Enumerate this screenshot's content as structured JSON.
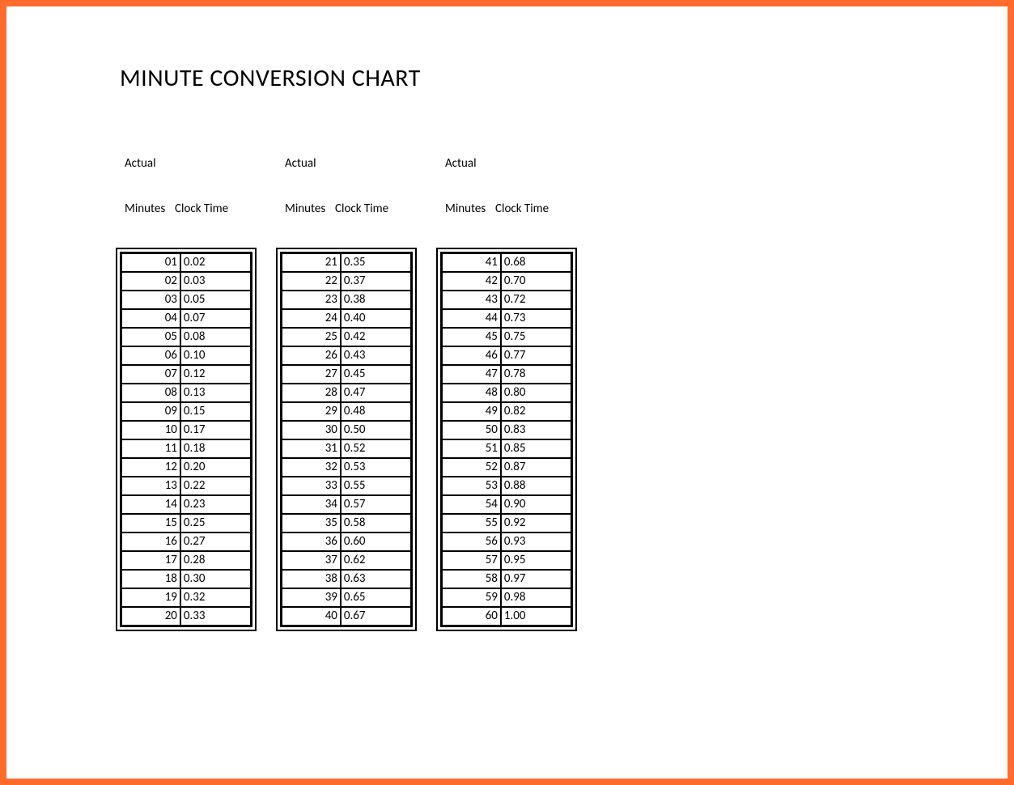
{
  "title": "MINUTE CONVERSION CHART",
  "headers": {
    "line1": "Actual",
    "col1": "Minutes",
    "col2": "Clock Time"
  },
  "chart_data": {
    "type": "table",
    "title": "Minute Conversion Chart",
    "columns": [
      "Actual Minutes",
      "Clock Time"
    ],
    "rows": [
      [
        "01",
        "0.02"
      ],
      [
        "02",
        "0.03"
      ],
      [
        "03",
        "0.05"
      ],
      [
        "04",
        "0.07"
      ],
      [
        "05",
        "0.08"
      ],
      [
        "06",
        "0.10"
      ],
      [
        "07",
        "0.12"
      ],
      [
        "08",
        "0.13"
      ],
      [
        "09",
        "0.15"
      ],
      [
        "10",
        "0.17"
      ],
      [
        "11",
        "0.18"
      ],
      [
        "12",
        "0.20"
      ],
      [
        "13",
        "0.22"
      ],
      [
        "14",
        "0.23"
      ],
      [
        "15",
        "0.25"
      ],
      [
        "16",
        "0.27"
      ],
      [
        "17",
        "0.28"
      ],
      [
        "18",
        "0.30"
      ],
      [
        "19",
        "0.32"
      ],
      [
        "20",
        "0.33"
      ],
      [
        "21",
        "0.35"
      ],
      [
        "22",
        "0.37"
      ],
      [
        "23",
        "0.38"
      ],
      [
        "24",
        "0.40"
      ],
      [
        "25",
        "0.42"
      ],
      [
        "26",
        "0.43"
      ],
      [
        "27",
        "0.45"
      ],
      [
        "28",
        "0.47"
      ],
      [
        "29",
        "0.48"
      ],
      [
        "30",
        "0.50"
      ],
      [
        "31",
        "0.52"
      ],
      [
        "32",
        "0.53"
      ],
      [
        "33",
        "0.55"
      ],
      [
        "34",
        "0.57"
      ],
      [
        "35",
        "0.58"
      ],
      [
        "36",
        "0.60"
      ],
      [
        "37",
        "0.62"
      ],
      [
        "38",
        "0.63"
      ],
      [
        "39",
        "0.65"
      ],
      [
        "40",
        "0.67"
      ],
      [
        "41",
        "0.68"
      ],
      [
        "42",
        "0.70"
      ],
      [
        "43",
        "0.72"
      ],
      [
        "44",
        "0.73"
      ],
      [
        "45",
        "0.75"
      ],
      [
        "46",
        "0.77"
      ],
      [
        "47",
        "0.78"
      ],
      [
        "48",
        "0.80"
      ],
      [
        "49",
        "0.82"
      ],
      [
        "50",
        "0.83"
      ],
      [
        "51",
        "0.85"
      ],
      [
        "52",
        "0.87"
      ],
      [
        "53",
        "0.88"
      ],
      [
        "54",
        "0.90"
      ],
      [
        "55",
        "0.92"
      ],
      [
        "56",
        "0.93"
      ],
      [
        "57",
        "0.95"
      ],
      [
        "58",
        "0.97"
      ],
      [
        "59",
        "0.98"
      ],
      [
        "60",
        "1.00"
      ]
    ]
  },
  "columns": [
    {
      "rows": [
        {
          "m": "01",
          "c": "0.02"
        },
        {
          "m": "02",
          "c": "0.03"
        },
        {
          "m": "03",
          "c": "0.05"
        },
        {
          "m": "04",
          "c": "0.07"
        },
        {
          "m": "05",
          "c": "0.08"
        },
        {
          "m": "06",
          "c": "0.10"
        },
        {
          "m": "07",
          "c": "0.12"
        },
        {
          "m": "08",
          "c": "0.13"
        },
        {
          "m": "09",
          "c": "0.15"
        },
        {
          "m": "10",
          "c": "0.17"
        },
        {
          "m": "11",
          "c": "0.18"
        },
        {
          "m": "12",
          "c": "0.20"
        },
        {
          "m": "13",
          "c": "0.22"
        },
        {
          "m": "14",
          "c": "0.23"
        },
        {
          "m": "15",
          "c": "0.25"
        },
        {
          "m": "16",
          "c": "0.27"
        },
        {
          "m": "17",
          "c": "0.28"
        },
        {
          "m": "18",
          "c": "0.30"
        },
        {
          "m": "19",
          "c": "0.32"
        },
        {
          "m": "20",
          "c": "0.33"
        }
      ]
    },
    {
      "rows": [
        {
          "m": "21",
          "c": "0.35"
        },
        {
          "m": "22",
          "c": "0.37"
        },
        {
          "m": "23",
          "c": "0.38"
        },
        {
          "m": "24",
          "c": "0.40"
        },
        {
          "m": "25",
          "c": "0.42"
        },
        {
          "m": "26",
          "c": "0.43"
        },
        {
          "m": "27",
          "c": "0.45"
        },
        {
          "m": "28",
          "c": "0.47"
        },
        {
          "m": "29",
          "c": "0.48"
        },
        {
          "m": "30",
          "c": "0.50"
        },
        {
          "m": "31",
          "c": "0.52"
        },
        {
          "m": "32",
          "c": "0.53"
        },
        {
          "m": "33",
          "c": "0.55"
        },
        {
          "m": "34",
          "c": "0.57"
        },
        {
          "m": "35",
          "c": "0.58"
        },
        {
          "m": "36",
          "c": "0.60"
        },
        {
          "m": "37",
          "c": "0.62"
        },
        {
          "m": "38",
          "c": "0.63"
        },
        {
          "m": "39",
          "c": "0.65"
        },
        {
          "m": "40",
          "c": "0.67"
        }
      ]
    },
    {
      "rows": [
        {
          "m": "41",
          "c": "0.68"
        },
        {
          "m": "42",
          "c": "0.70"
        },
        {
          "m": "43",
          "c": "0.72"
        },
        {
          "m": "44",
          "c": "0.73"
        },
        {
          "m": "45",
          "c": "0.75"
        },
        {
          "m": "46",
          "c": "0.77"
        },
        {
          "m": "47",
          "c": "0.78"
        },
        {
          "m": "48",
          "c": "0.80"
        },
        {
          "m": "49",
          "c": "0.82"
        },
        {
          "m": "50",
          "c": "0.83"
        },
        {
          "m": "51",
          "c": "0.85"
        },
        {
          "m": "52",
          "c": "0.87"
        },
        {
          "m": "53",
          "c": "0.88"
        },
        {
          "m": "54",
          "c": "0.90"
        },
        {
          "m": "55",
          "c": "0.92"
        },
        {
          "m": "56",
          "c": "0.93"
        },
        {
          "m": "57",
          "c": "0.95"
        },
        {
          "m": "58",
          "c": "0.97"
        },
        {
          "m": "59",
          "c": "0.98"
        },
        {
          "m": "60",
          "c": "1.00"
        }
      ]
    }
  ]
}
